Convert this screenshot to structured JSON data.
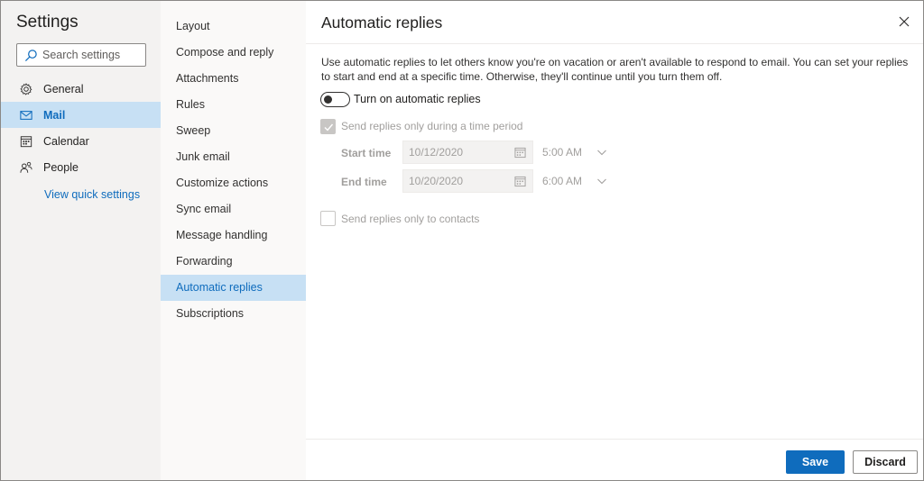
{
  "nav": {
    "title": "Settings",
    "search_placeholder": "Search settings",
    "items": [
      {
        "label": "General",
        "icon": "gear-icon"
      },
      {
        "label": "Mail",
        "icon": "mail-icon"
      },
      {
        "label": "Calendar",
        "icon": "calendar-icon"
      },
      {
        "label": "People",
        "icon": "people-icon"
      }
    ],
    "quick_settings": "View quick settings"
  },
  "menu": {
    "items": [
      "Layout",
      "Compose and reply",
      "Attachments",
      "Rules",
      "Sweep",
      "Junk email",
      "Customize actions",
      "Sync email",
      "Message handling",
      "Forwarding",
      "Automatic replies",
      "Subscriptions"
    ],
    "selected": "Automatic replies"
  },
  "content": {
    "title": "Automatic replies",
    "description": "Use automatic replies to let others know you're on vacation or aren't available to respond to email. You can set your replies to start and end at a specific time. Otherwise, they'll continue until you turn them off.",
    "toggle_label": "Turn on automatic replies",
    "toggle_on": false,
    "time_period_label": "Send replies only during a time period",
    "time_period_checked": true,
    "start_label": "Start time",
    "start_date": "10/12/2020",
    "start_time": "5:00 AM",
    "end_label": "End time",
    "end_date": "10/20/2020",
    "end_time": "6:00 AM",
    "contacts_label": "Send replies only to contacts",
    "contacts_checked": false
  },
  "footer": {
    "save_label": "Save",
    "discard_label": "Discard"
  },
  "colors": {
    "accent": "#0f6cbd",
    "selected_bg": "#c7e0f4",
    "nav_bg": "#f3f2f1",
    "disabled_text": "#a19f9d"
  }
}
